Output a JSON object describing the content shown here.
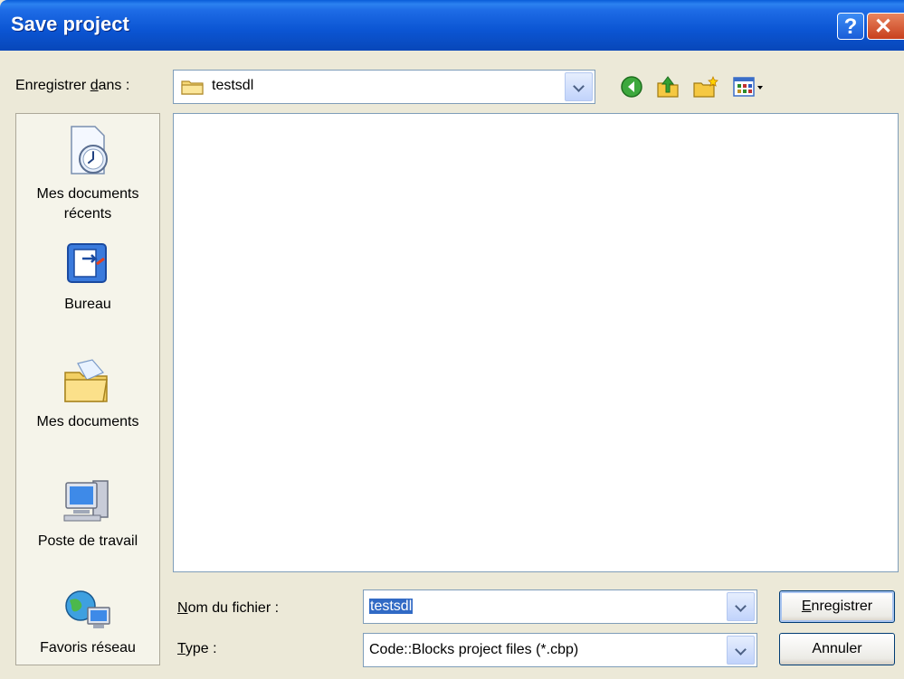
{
  "window": {
    "title": "Save project",
    "help_glyph": "?",
    "close_glyph": "✕"
  },
  "toolbar": {
    "save_in_label": "Enregistrer dans :",
    "save_in_prefix": "Enregistrer ",
    "save_in_accel": "d",
    "save_in_suffix": "ans :",
    "current_folder": "testsdl",
    "icons": [
      "back-icon",
      "up-folder-icon",
      "new-folder-icon",
      "view-menu-icon"
    ]
  },
  "places": [
    {
      "label": "Mes documents récents",
      "line1": "Mes documents",
      "line2": "récents",
      "icon": "recent-documents-icon"
    },
    {
      "label": "Bureau",
      "icon": "desktop-icon"
    },
    {
      "label": "Mes documents",
      "icon": "my-documents-icon"
    },
    {
      "label": "Poste de travail",
      "icon": "my-computer-icon"
    },
    {
      "label": "Favoris réseau",
      "icon": "network-places-icon"
    }
  ],
  "filename": {
    "label": "Nom du fichier :",
    "label_accel": "N",
    "label_rest": "om du fichier :",
    "value": "testsdl"
  },
  "filetype": {
    "label": "Type :",
    "label_accel": "T",
    "label_rest": "ype :",
    "value": "Code::Blocks project files (*.cbp)"
  },
  "buttons": {
    "save": "Enregistrer",
    "save_accel": "E",
    "save_rest": "nregistrer",
    "cancel": "Annuler"
  },
  "colors": {
    "titlebar": "#0A5CD8",
    "dialog_bg": "#ECE9D8",
    "selection": "#316AC5"
  }
}
